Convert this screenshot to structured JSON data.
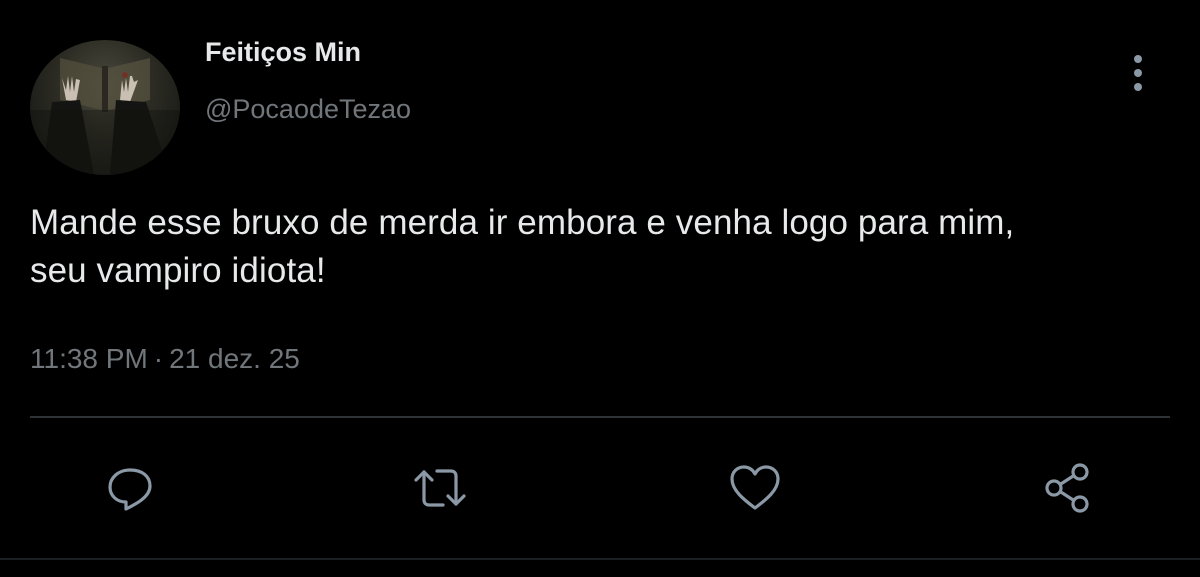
{
  "tweet": {
    "display_name": "Feitiços Min",
    "handle": "@PocaodeTezao",
    "text_lines": [
      "Mande esse bruxo de merda ir embora e venha logo para mim,",
      "seu vampiro idiota!"
    ],
    "time": "11:38 PM",
    "separator": "·",
    "date": "21 dez. 25"
  },
  "icons": {
    "more": "more-vertical-icon",
    "reply": "reply-icon",
    "retweet": "retweet-icon",
    "like": "heart-icon",
    "share": "share-icon"
  },
  "colors": {
    "background": "#000000",
    "text_primary": "#e7e9ea",
    "text_secondary": "#71767b",
    "divider": "#2f3336",
    "icon": "#8b98a5"
  }
}
